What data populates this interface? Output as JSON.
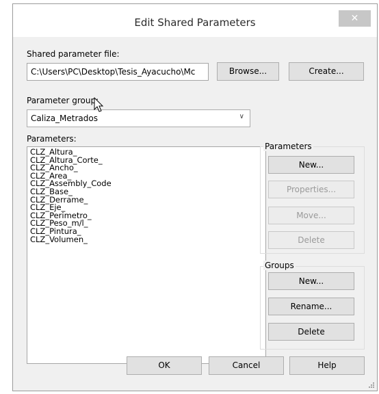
{
  "window": {
    "title": "Edit Shared Parameters",
    "close_glyph": "✕"
  },
  "shared_file": {
    "label": "Shared parameter file:",
    "path": "C:\\Users\\PC\\Desktop\\Tesis_Ayacucho\\Mc",
    "browse_label": "Browse...",
    "create_label": "Create..."
  },
  "group_select": {
    "label": "Parameter group:",
    "value": "Caliza_Metrados"
  },
  "parameters_list": {
    "label": "Parameters:",
    "items": [
      "CLZ_Altura_",
      "CLZ_Altura_Corte_",
      "CLZ_Ancho_",
      "CLZ_Area_",
      "CLZ_Assembly_Code",
      "CLZ_Base_",
      "CLZ_Derrame_",
      "CLZ_Eje_",
      "CLZ_Perimetro_",
      "CLZ_Peso_m/l_",
      "CLZ_Pintura_",
      "CLZ_Volumen_"
    ]
  },
  "parameters_box": {
    "title": "Parameters",
    "new_label": "New...",
    "properties_label": "Properties...",
    "move_label": "Move...",
    "delete_label": "Delete"
  },
  "groups_box": {
    "title": "Groups",
    "new_label": "New...",
    "rename_label": "Rename...",
    "delete_label": "Delete"
  },
  "footer": {
    "ok_label": "OK",
    "cancel_label": "Cancel",
    "help_label": "Help"
  }
}
